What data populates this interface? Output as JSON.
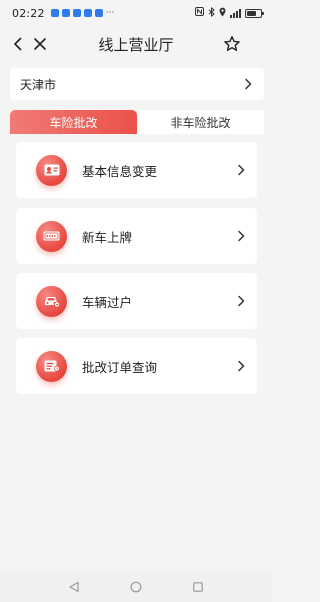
{
  "status_bar": {
    "time": "02:22",
    "notification_icons": [
      "app-icon",
      "app-icon",
      "app-icon",
      "app-icon",
      "app-icon"
    ],
    "more_glyph": "···",
    "status_icons": [
      "nfc-icon",
      "bluetooth-icon",
      "location-icon",
      "signal-icon",
      "battery-icon"
    ],
    "battery_level": 0.7
  },
  "header": {
    "title": "线上营业厅",
    "icons": [
      "back-icon",
      "close-icon",
      "star-icon"
    ]
  },
  "city": {
    "name": "天津市",
    "icon": "chevron-right-icon"
  },
  "tabs": [
    {
      "label": "车险批改",
      "active": true
    },
    {
      "label": "非车险批改",
      "active": false
    }
  ],
  "menu": {
    "items": [
      {
        "label": "基本信息变更",
        "icon": "id-card-icon"
      },
      {
        "label": "新车上牌",
        "icon": "license-plate-icon"
      },
      {
        "label": "车辆过户",
        "icon": "car-transfer-icon"
      },
      {
        "label": "批改订单查询",
        "icon": "order-list-icon"
      }
    ]
  },
  "system_nav": {
    "icons": [
      "back-triangle-icon",
      "home-circle-icon",
      "recents-square-icon"
    ]
  },
  "colors": {
    "accent": "#ea5149",
    "accent_light": "#f07b76",
    "background": "#f4f4f4",
    "card": "#ffffff"
  }
}
